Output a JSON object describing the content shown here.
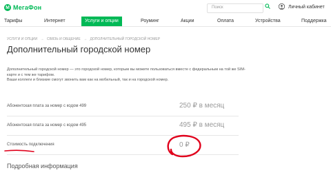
{
  "header": {
    "logo_mark": "M",
    "logo_text": "МегаФон",
    "search_placeholder": "Поиск",
    "account_label": "Личный кабинет",
    "brand_color": "#00b956"
  },
  "nav": {
    "items": [
      {
        "label": "Тарифы"
      },
      {
        "label": "Интернет"
      },
      {
        "label": "Услуги и опции",
        "active": true
      },
      {
        "label": "Роуминг"
      },
      {
        "label": "Акции"
      },
      {
        "label": "Оплата"
      },
      {
        "label": "Устройства"
      },
      {
        "label": "Поддержка"
      }
    ]
  },
  "breadcrumb": {
    "items": [
      "УСЛУГИ И ОПЦИИ",
      "→",
      "СВЯЗЬ И ОБЩЕНИЕ",
      "→",
      "ДОПОЛНИТЕЛЬНЫЙ ГОРОДСКОЙ НОМЕР"
    ]
  },
  "page": {
    "title": "Дополнительный городской номер",
    "description_1": "Дополнительный городской номер — это городской номер, которым вы можете пользоваться вместе с федеральным на той же SIM-карте и с тем же тарифом.",
    "description_2": "Ваши коллеги и близкие смогут звонить вам как на мобильный, так и на городской номер."
  },
  "prices": [
    {
      "label": "Абонентская плата за номер с кодом 499",
      "value": "250 ₽ в месяц"
    },
    {
      "label": "Абонентская плата за номер с кодом 495",
      "value": "495 ₽ в месяц"
    },
    {
      "label": "Стоимость подключения",
      "value": "0 ₽"
    }
  ],
  "more_info": "Подробная информация",
  "annotation_color": "#e0001b"
}
